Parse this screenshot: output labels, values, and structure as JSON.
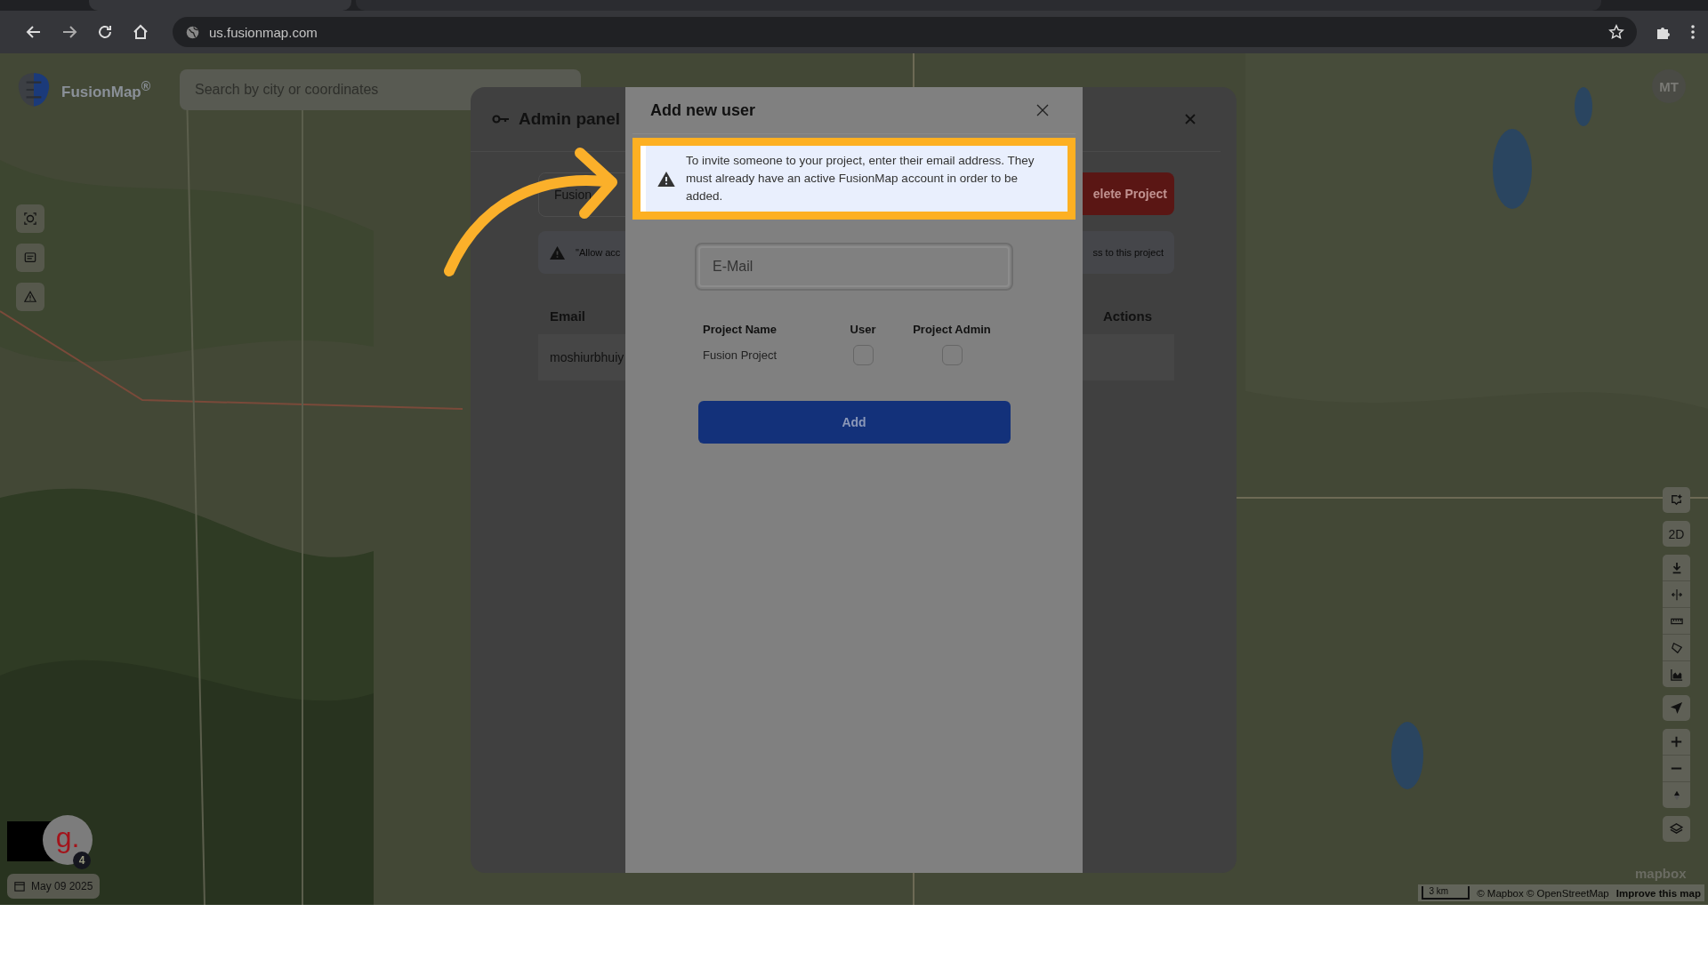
{
  "browser": {
    "url": "us.fusionmap.com"
  },
  "app": {
    "logo": "FusionMap$^{®}$",
    "search": {
      "placeholder": "Search by city or coordinates"
    },
    "avatar": "MT",
    "brand_mark": "g.",
    "badge": "4",
    "date": "May 09 2025",
    "view_toggle": "2D",
    "map_logo": "mapbox",
    "scale": "3 km",
    "attribution": "© Mapbox © OpenStreetMap",
    "improve_link": "Improve this map"
  },
  "admin_panel": {
    "title": "Admin panel",
    "project_button": "Fusion",
    "delete_button": "elete Project",
    "notice_left": "\"Allow acc",
    "notice_right": "ss to this project",
    "columns": [
      "Email",
      "Actions"
    ],
    "rows": [
      {
        "email": "moshiurbhuiy"
      }
    ]
  },
  "dialog": {
    "title": "Add new user",
    "notice": "To invite someone to your project, enter their email address. They must already have an active FusionMap account in order to be added.",
    "email": {
      "placeholder": "E-Mail"
    },
    "columns": [
      "Project Name",
      "User",
      "Project Admin"
    ],
    "projects": [
      {
        "name": "Fusion Project",
        "user": false,
        "admin": false
      }
    ],
    "add_button": "Add"
  }
}
